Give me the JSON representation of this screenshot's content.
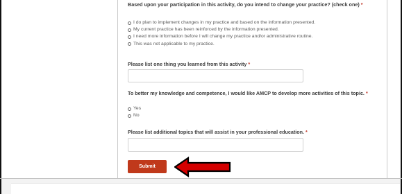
{
  "form": {
    "question1": {
      "text": "Based upon your participation in this activity, do you intend to change your practice? (check one)",
      "required_mark": "*",
      "options": [
        "I do plan to implement changes in my practice and based on the information presented.",
        "My current practice has been reinforced by the information presented.",
        "I need more information before I will change my practice and/or administrative routine.",
        "This was not applicable to my practice."
      ]
    },
    "question2": {
      "text": "Please list one thing you learned from this activity",
      "required_mark": "*",
      "value": ""
    },
    "question3": {
      "text": "To better my knowledge and competence, I would like AMCP to develop more activities of this topic.",
      "required_mark": "*",
      "options": [
        "Yes",
        "No"
      ]
    },
    "question4": {
      "text": "Please list additional topics that will assist in your professional education.",
      "required_mark": "*",
      "value": ""
    },
    "submit_label": "Submit"
  },
  "colors": {
    "submit_button": "#c0391b",
    "arrow_fill": "#d40000",
    "required": "#c0392b"
  }
}
